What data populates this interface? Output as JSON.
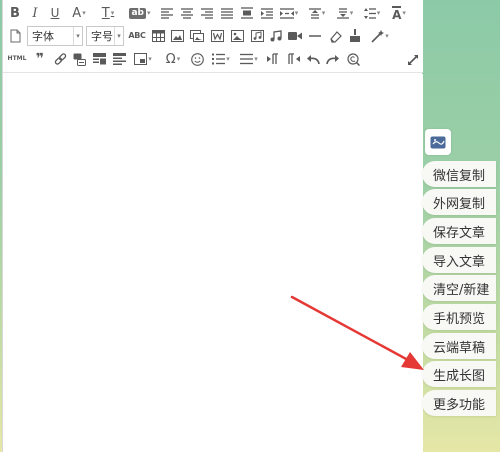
{
  "toolbar": {
    "bold_label": "B",
    "italic_label": "I",
    "underline_label": "U",
    "font_color_label": "A",
    "font_bg_label": "T",
    "highlight_label": "ab",
    "font_family_value": "字体",
    "font_size_value": "字号",
    "spellcheck_label": "ABC",
    "html_label": "HTML",
    "quote_label": "❞",
    "line_height_label": "A",
    "caret": "▾"
  },
  "sidebar": {
    "items": [
      {
        "label": "微信复制"
      },
      {
        "label": "外网复制"
      },
      {
        "label": "保存文章"
      },
      {
        "label": "导入文章"
      },
      {
        "label": "清空/新建"
      },
      {
        "label": "手机预览"
      },
      {
        "label": "云端草稿"
      },
      {
        "label": "生成长图"
      },
      {
        "label": "更多功能"
      }
    ]
  },
  "colors": {
    "arrow": "#e53935",
    "icon": "#5a5a5a",
    "sidebar_button_bg": "#f8f8f5",
    "bg_top": "#8ccaa7",
    "bg_bottom": "#e6e7a6"
  }
}
